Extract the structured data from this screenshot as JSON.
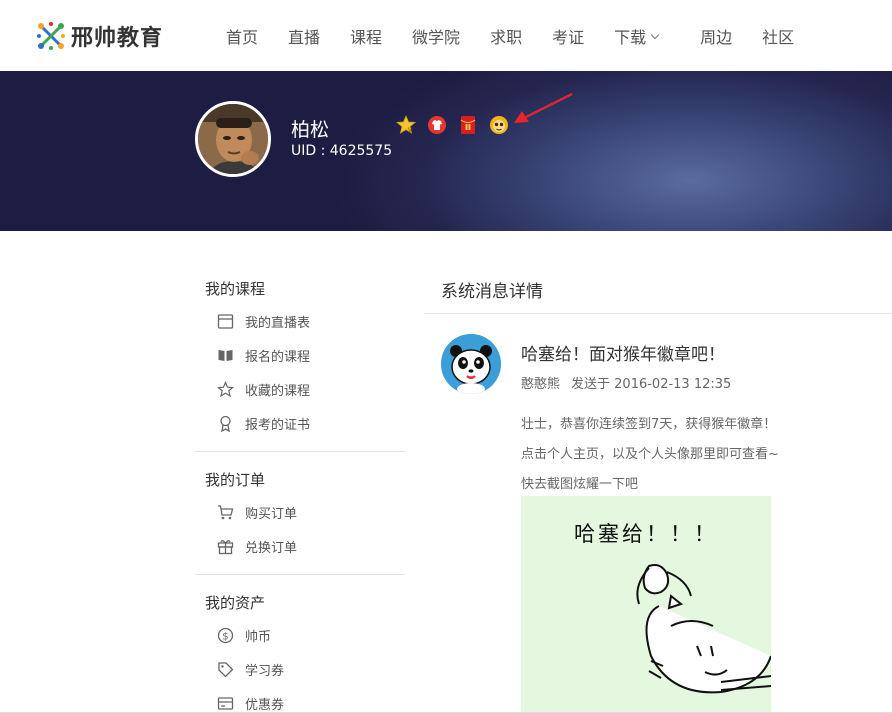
{
  "header": {
    "logo_text": "邢帅教育",
    "nav": [
      "首页",
      "直播",
      "课程",
      "微学院",
      "求职",
      "考证",
      "下载",
      "周边",
      "社区"
    ],
    "dropdown_index": 6
  },
  "profile": {
    "name": "柏松",
    "uid": "UID : 4625575",
    "badges": [
      "star-vip-badge",
      "red-shirt-badge",
      "red-envelope-badge",
      "monkey-year-badge"
    ]
  },
  "sidebar": {
    "sections": [
      {
        "title": "我的课程",
        "items": [
          {
            "label": "我的直播表",
            "icon": "calendar-icon"
          },
          {
            "label": "报名的课程",
            "icon": "book-icon"
          },
          {
            "label": "收藏的课程",
            "icon": "star-icon"
          },
          {
            "label": "报考的证书",
            "icon": "ribbon-icon"
          }
        ]
      },
      {
        "title": "我的订单",
        "items": [
          {
            "label": "购买订单",
            "icon": "cart-icon"
          },
          {
            "label": "兑换订单",
            "icon": "gift-icon"
          }
        ]
      },
      {
        "title": "我的资产",
        "items": [
          {
            "label": "帅币",
            "icon": "coin-icon"
          },
          {
            "label": "学习券",
            "icon": "tag-icon"
          },
          {
            "label": "优惠券",
            "icon": "card-icon"
          }
        ]
      }
    ]
  },
  "content": {
    "title": "系统消息详情",
    "message": {
      "title": "哈塞给！面对猴年徽章吧！",
      "sender": "憨憨熊",
      "sent_at": "发送于 2016-02-13 12:35",
      "lines": [
        "壮士，恭喜你连续签到7天，获得猴年徽章！",
        "点击个人主页，以及个人头像那里即可查看~",
        "快去截图炫耀一下吧"
      ],
      "comic_caption": "哈塞给！！！"
    }
  },
  "colors": {
    "banner_dark": "#1d1c42",
    "banner_light": "#5b6ba0",
    "arrow": "#e8262a",
    "logo_orange": "#f5a623",
    "logo_green": "#3aa655",
    "logo_blue": "#2e6fcf"
  }
}
